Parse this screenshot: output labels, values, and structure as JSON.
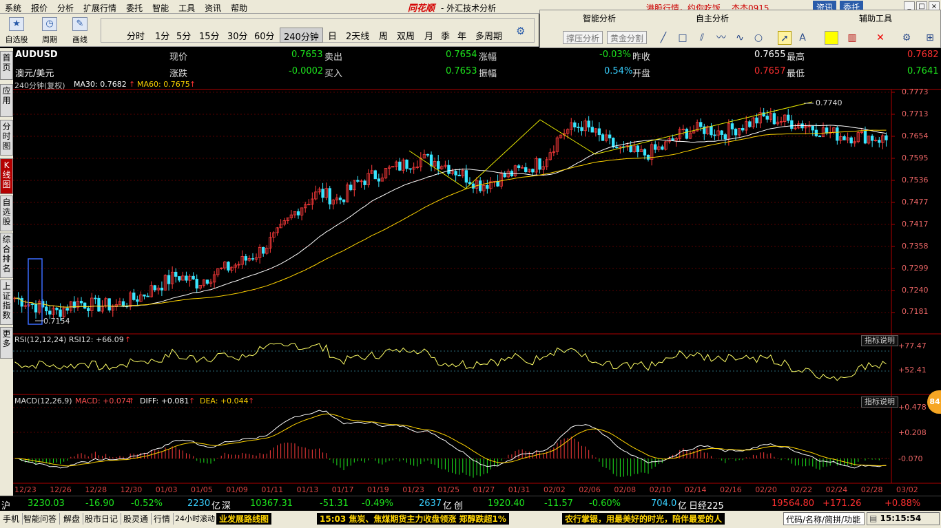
{
  "menu": {
    "items": [
      "系统",
      "报价",
      "分析",
      "扩展行情",
      "委托",
      "智能",
      "工具",
      "资讯",
      "帮助"
    ],
    "logo": "同花顺",
    "title": "- 外汇技术分析",
    "promo": "港股行情，约你吃饭",
    "user": "杰杰0915",
    "btn_info": "资讯",
    "btn_trade": "委托"
  },
  "toolbar": {
    "buttons": [
      {
        "label": "自选股",
        "icon": "star-icon"
      },
      {
        "label": "周期",
        "icon": "clock-icon"
      },
      {
        "label": "画线",
        "icon": "pen-icon"
      }
    ],
    "periods": [
      "分时",
      "1分",
      "5分",
      "15分",
      "30分",
      "60分",
      "240分钟",
      "日",
      "2天线",
      "周",
      "双周",
      "月",
      "季",
      "年",
      "多周期"
    ],
    "active_period": "240分钟"
  },
  "panel2": {
    "headers": {
      "smart": "智能分析",
      "self": "自主分析",
      "aux": "辅助工具"
    },
    "buttons": {
      "support": "撑压分析",
      "golden": "黄金分割"
    }
  },
  "leftbar": {
    "tabs": [
      "首页",
      "应用",
      "分时图",
      "K线图",
      "自选股",
      "综合排名",
      "上证指数",
      "更多"
    ],
    "active": "K线图"
  },
  "quote": {
    "symbol": "AUDUSD",
    "name": "澳元/美元",
    "price_label": "现价",
    "price": "0.7653",
    "change_label": "涨跌",
    "change": "-0.0002",
    "sell_label": "卖出",
    "sell": "0.7654",
    "buy_label": "买入",
    "buy": "0.7653",
    "pct_label": "涨幅",
    "pct": "-0.03%",
    "amp_label": "振幅",
    "amp": "0.54%",
    "prev_label": "昨收",
    "prev": "0.7655",
    "open_label": "开盘",
    "open": "0.7657",
    "high_label": "最高",
    "high": "0.7682",
    "low_label": "最低",
    "low": "0.7641"
  },
  "ma_line": {
    "period": "240分钟(复权)",
    "ma30": "MA30: 0.7682",
    "ma60": "MA60: 0.7675"
  },
  "rsi_line": {
    "text": "RSI(12,12,24)  RSI12: +66.09"
  },
  "macd_line": {
    "name": "MACD(12,26,9)",
    "macd": "MACD: +0.074",
    "diff": "DIFF: +0.081",
    "dea": "DEA: +0.044"
  },
  "indicator_btn": "指标说明",
  "annotations": {
    "high": "0.7740",
    "low": "0.7154"
  },
  "badge": "84",
  "price_axis": [
    "0.7773",
    "0.7713",
    "0.7654",
    "0.7595",
    "0.7536",
    "0.7477",
    "0.7417",
    "0.7358",
    "0.7299",
    "0.7240",
    "0.7181"
  ],
  "rsi_axis": [
    "+77.47",
    "+52.41"
  ],
  "macd_axis": [
    "+0.478",
    "+0.208",
    "-0.070"
  ],
  "dates": [
    "12/23",
    "12/26",
    "12/28",
    "12/30",
    "01/03",
    "01/05",
    "01/09",
    "01/11",
    "01/13",
    "01/17",
    "01/19",
    "01/23",
    "01/25",
    "01/27",
    "01/31",
    "02/02",
    "02/06",
    "02/08",
    "02/10",
    "02/14",
    "02/16",
    "02/20",
    "02/22",
    "02/24",
    "02/28",
    "03/02"
  ],
  "chart_data": {
    "type": "line",
    "title": "AUDUSD 240分钟",
    "y_range": [
      0.715,
      0.779
    ],
    "approx_close": [
      0.724,
      0.722,
      0.72,
      0.723,
      0.722,
      0.722,
      0.724,
      0.727,
      0.73,
      0.728,
      0.731,
      0.733,
      0.736,
      0.741,
      0.748,
      0.752,
      0.75,
      0.755,
      0.757,
      0.759,
      0.761,
      0.76,
      0.757,
      0.754,
      0.756,
      0.758,
      0.76,
      0.768,
      0.77,
      0.766,
      0.763,
      0.762,
      0.764,
      0.768,
      0.769,
      0.768,
      0.77,
      0.772,
      0.771,
      0.77,
      0.768,
      0.767,
      0.767,
      0.766
    ],
    "annotations": {
      "high": 0.774,
      "low": 0.7154
    },
    "ma30": 0.7682,
    "ma60": 0.7675,
    "rsi12": 66.09,
    "macd": {
      "macd": 0.074,
      "diff": 0.081,
      "dea": 0.044
    }
  },
  "status": {
    "sh_label": "沪",
    "sh_val": "3230.03",
    "sh_chg": "-16.90",
    "sh_pct": "-0.52%",
    "sh_amt": "2230",
    "sh_unit": "亿",
    "sz_label": "深",
    "sz_val": "10367.31",
    "sz_chg": "-51.31",
    "sz_pct": "-0.49%",
    "sz_amt": "2637",
    "sz_unit": "亿",
    "cy_label": "创",
    "cy_val": "1920.40",
    "cy_chg": "-11.57",
    "cy_pct": "-0.60%",
    "cy_amt": "704.0",
    "cy_unit": "亿",
    "nk_label": "日经225",
    "nk_val": "19564.80",
    "nk_chg": "+171.26",
    "nk_pct": "+0.88%"
  },
  "bottom": {
    "items": [
      "手机",
      "智能问答",
      "解盘",
      "股市日记",
      "股灵通",
      "行情",
      "24小时滚动"
    ],
    "ticker1": "业发展路线图",
    "ticker2": "15:03 焦炭、焦煤期货主力收盘领涨 郑醇跌超1%",
    "ticker3": "农行掌银，用最美好的时光，陪伴最爱的人",
    "search_placeholder": "代码/名称/简拼/功能",
    "clock": "15:15:54"
  }
}
